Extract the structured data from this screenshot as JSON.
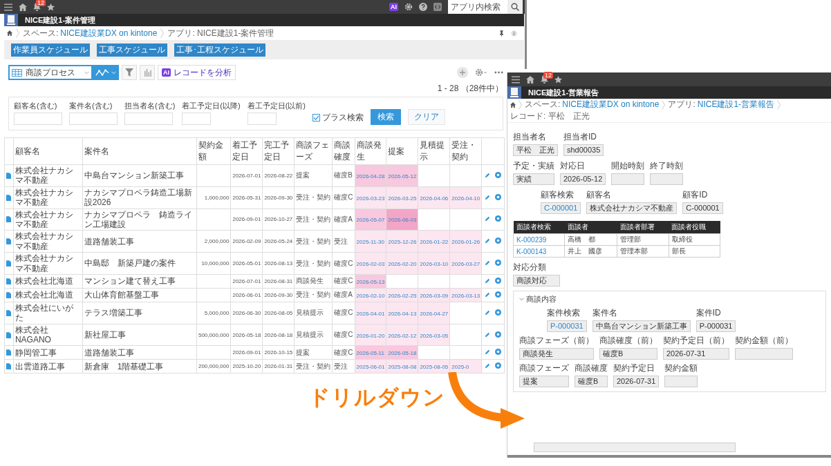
{
  "left_window": {
    "top_bar": {
      "notification_count": "12",
      "ai_badge": "AI",
      "search": {
        "placeholder": "アプリ内検索"
      }
    },
    "app_title": "NICE建設1-案件管理",
    "breadcrumb": [
      {
        "kind": "link",
        "prefix": "スペース:",
        "text": "NICE建設業DX on kintone"
      },
      {
        "kind": "current",
        "text": "アプリ: NICE建設1-案件管理"
      }
    ],
    "link_buttons": [
      "作業員スケジュール",
      "工事スケジュール",
      "工事･工程スケジュール"
    ],
    "toolbar": {
      "view": "商談プロセス",
      "ai_button": {
        "badge": "AI",
        "label": "レコードを分析"
      }
    },
    "record_count": "1 - 28 （28件中）",
    "search_panel": {
      "fields": [
        {
          "label": "顧客名(含む)"
        },
        {
          "label": "案件名(含む)"
        },
        {
          "label": "担当者名(含む)"
        },
        {
          "label": "着工予定日(以降)"
        },
        {
          "label": "着工予定日(以前)"
        }
      ],
      "plus_search": {
        "label": "プラス検索",
        "checked": true
      },
      "search_button": "検索",
      "clear_button": "クリア"
    },
    "table": {
      "columns": [
        "顧客名",
        "案件名",
        "契約金額",
        "着工予定日",
        "完工予定日",
        "商談フェーズ",
        "商談確度",
        "商談発生",
        "提案",
        "見積提示",
        "受注・契約"
      ],
      "rows": [
        {
          "customer": "株式会社ナカシマ不動産",
          "project": "中島台マンション新築工事",
          "start": "2026-07-01",
          "end": "2026-08-22",
          "phase": "提案",
          "probability": "確度B",
          "stages": [
            {
              "date": "2026-04-28",
              "color": "#f8c8de"
            },
            {
              "date": "2026-05-12",
              "color": "#f8c8de"
            }
          ]
        },
        {
          "customer": "株式会社ナカシマ不動産",
          "project": "ナカシマプロペラ鋳造工場新設2026",
          "amount": "1,000,000",
          "start": "2026-05-31",
          "end": "2026-09-30",
          "phase": "受注・契約",
          "probability": "確度C",
          "stages": [
            {
              "date": "2026-03-23",
              "color": "#fce6f0"
            },
            {
              "date": "2026-03-25",
              "color": "#fce6f0"
            },
            {
              "date": "2026-04-06",
              "color": "#fce6f0"
            },
            {
              "date": "2026-04-10",
              "color": "#fce6f0"
            }
          ]
        },
        {
          "customer": "株式会社ナカシマ不動産",
          "project": "ナカシマプロペラ　鋳造ライン工場建設",
          "start": "2026-09-01",
          "end": "2026-10-27",
          "phase": "受注・契約",
          "probability": "確度A",
          "stages": [
            {
              "date": "2026-05-07",
              "color": "#f8c8de"
            },
            {
              "date": "2026-06-03",
              "color": "#f3a5c8"
            }
          ]
        },
        {
          "customer": "株式会社ナカシマ不動産",
          "project": "道路舗装工事",
          "amount": "2,000,000",
          "start": "2026-02-09",
          "end": "2026-05-24",
          "phase": "受注・契約",
          "probability": "受注",
          "stages": [
            {
              "date": "2025-11-30",
              "color": "#fce6f0"
            },
            {
              "date": "2025-12-26",
              "color": "#fce6f0"
            },
            {
              "date": "2026-01-22",
              "color": "#fce6f0"
            },
            {
              "date": "2026-01-26",
              "color": "#fce6f0"
            }
          ]
        },
        {
          "customer": "株式会社ナカシマ不動産",
          "project": "中島邸　新築戸建の案件",
          "amount": "10,000,000",
          "start": "2026-05-01",
          "end": "2026-08-13",
          "phase": "受注・契約",
          "probability": "確度C",
          "stages": [
            {
              "date": "2026-02-03",
              "color": "#fce6f0"
            },
            {
              "date": "2026-02-20",
              "color": "#fce6f0"
            },
            {
              "date": "2026-03-10",
              "color": "#fce6f0"
            },
            {
              "date": "2026-03-27",
              "color": "#fce6f0"
            }
          ]
        },
        {
          "customer": "株式会社北海道",
          "project": "マンション建て替え工事",
          "start": "2026-07-01",
          "end": "2026-08-31",
          "phase": "商談発生",
          "probability": "確度C",
          "stages": [
            {
              "date": "2026-05-13",
              "color": "#f8c8de"
            }
          ]
        },
        {
          "customer": "株式会社北海道",
          "project": "大山体育館基盤工事",
          "start": "2026-06-01",
          "end": "2026-09-30",
          "phase": "受注・契約",
          "probability": "確度A",
          "stages": [
            {
              "date": "2026-02-10",
              "color": "#fce6f0"
            },
            {
              "date": "2026-02-25",
              "color": "#fce6f0"
            },
            {
              "date": "2026-03-09",
              "color": "#fce6f0"
            },
            {
              "date": "2026-03-13",
              "color": "#fce6f0"
            }
          ]
        },
        {
          "customer": "株式会社にいがた",
          "project": "テラス増築工事",
          "amount": "5,000,000",
          "start": "2026-06-30",
          "end": "2026-08-05",
          "phase": "見積提示",
          "probability": "確度C",
          "stages": [
            {
              "date": "2026-04-01",
              "color": "#fce6f0"
            },
            {
              "date": "2026-04-13",
              "color": "#fce6f0"
            },
            {
              "date": "2026-04-27",
              "color": "#fce6f0"
            }
          ]
        },
        {
          "customer": "株式会社NAGANO",
          "project": "新社屋工事",
          "amount": "500,000,000",
          "start": "2026-05-18",
          "end": "2026-08-18",
          "phase": "見積提示",
          "probability": "確度C",
          "stages": [
            {
              "date": "2026-01-20",
              "color": "#fce6f0"
            },
            {
              "date": "2026-02-12",
              "color": "#fce6f0"
            },
            {
              "date": "2026-03-05",
              "color": "#fce6f0"
            }
          ]
        },
        {
          "customer": "静岡管工事",
          "project": "道路舗装工事",
          "start": "2026-09-01",
          "end": "2026-10-15",
          "phase": "提案",
          "probability": "確度C",
          "stages": [
            {
              "date": "2026-05-11",
              "color": "#f8c8de"
            },
            {
              "date": "2026-05-18",
              "color": "#f8c8de"
            }
          ]
        },
        {
          "customer": "出雲道路工事",
          "project": "新倉庫　1階基礎工事",
          "amount": "200,000,000",
          "start": "2025-10-20",
          "end": "2026-01-31",
          "phase": "受注・契約",
          "probability": "受注",
          "stages": [
            {
              "date": "2025-06-01",
              "color": "#fce6f0"
            },
            {
              "date": "2025-08-08",
              "color": "#fce6f0"
            },
            {
              "date": "2025-08-05",
              "color": "#fce6f0"
            },
            {
              "date": "2025-0",
              "color": "#fce6f0"
            }
          ]
        }
      ]
    }
  },
  "right_window": {
    "top_bar": {
      "notification_count": "12"
    },
    "app_title": "NICE建設1-営業報告",
    "breadcrumb": [
      {
        "kind": "link",
        "prefix": "スペース:",
        "text": "NICE建設業DX on kintone"
      },
      {
        "kind": "link",
        "prefix": "アプリ:",
        "text": "NICE建設1-営業報告"
      },
      {
        "kind": "current",
        "text": "レコード: 平松　正光"
      }
    ],
    "form_rows": [
      {
        "fields": [
          {
            "label": "担当者名",
            "value": "平松　正光",
            "kind": "text"
          },
          {
            "label": "担当者ID",
            "value": "shd00035",
            "kind": "text"
          }
        ]
      },
      {
        "fields": [
          {
            "label": "予定・実績",
            "value": "実績",
            "kind": "text"
          },
          {
            "label": "対応日",
            "value": "2026-05-12",
            "kind": "text"
          },
          {
            "label": "開始時刻",
            "kind": "text"
          },
          {
            "label": "終了時刻",
            "kind": "text"
          }
        ]
      },
      {
        "fields": [
          {
            "label": "顧客検索",
            "value": "C-000001",
            "kind": "lookup"
          },
          {
            "label": "顧客名",
            "value": "株式会社ナカシマ不動産",
            "kind": "text"
          },
          {
            "label": "顧客ID",
            "value": "C-000001",
            "kind": "text"
          }
        ]
      }
    ],
    "attendees": {
      "columns": [
        "面談者検索",
        "面談者",
        "面談者部署",
        "面談者役職"
      ],
      "rows": [
        [
          "K-000239",
          "高橋　都",
          "管理部",
          "取締役"
        ],
        [
          "K-000143",
          "井上　國彦",
          "管理本部",
          "部長"
        ]
      ]
    },
    "category": {
      "label": "対応分類",
      "value": "商談対応"
    },
    "group": {
      "title": "商談内容",
      "expanded": true,
      "rows": [
        {
          "fields": [
            {
              "label": "案件検索",
              "value": "P-000031",
              "kind": "lookup"
            },
            {
              "label": "案件名",
              "value": "中島台マンション新築工事",
              "kind": "text"
            },
            {
              "label": "案件ID",
              "value": "P-000031",
              "kind": "text"
            }
          ]
        },
        {
          "fields": [
            {
              "label": "商談フェーズ（前）",
              "value": "商談発生",
              "kind": "text"
            },
            {
              "label": "商談確度（前）",
              "value": "確度B",
              "kind": "text"
            },
            {
              "label": "契約予定日（前）",
              "value": "2026-07-31",
              "kind": "text"
            },
            {
              "label": "契約金額（前）",
              "kind": "text"
            }
          ]
        },
        {
          "fields": [
            {
              "label": "商談フェーズ",
              "value": "提案",
              "kind": "text"
            },
            {
              "label": "商談確度",
              "value": "確度B",
              "kind": "text"
            },
            {
              "label": "契約予定日",
              "value": "2026-07-31",
              "kind": "text"
            },
            {
              "label": "契約金額",
              "kind": "text"
            }
          ]
        }
      ]
    }
  },
  "annotation": {
    "label": "ドリルダウン"
  }
}
